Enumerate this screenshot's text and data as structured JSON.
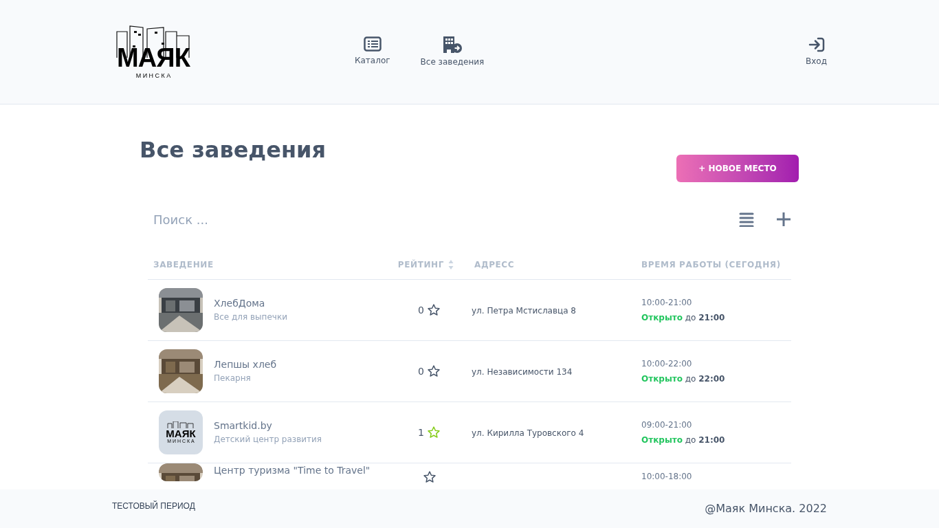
{
  "header": {
    "logo": {
      "title": "МАЯК",
      "subtitle": "М И Н С К А"
    },
    "nav": [
      {
        "label": "Каталог",
        "kind": "catalog"
      },
      {
        "label": "Все заведения",
        "kind": "places"
      }
    ],
    "login": {
      "label": "Вход"
    }
  },
  "page": {
    "title": "Все заведения",
    "new_button": "+ НОВОЕ МЕСТО",
    "search": {
      "placeholder": "Поиск ..."
    }
  },
  "table": {
    "columns": [
      {
        "label": "ЗАВЕДЕНИЕ",
        "sortable": false
      },
      {
        "label": "РЕЙТИНГ",
        "sortable": true
      },
      {
        "label": "АДРЕСС",
        "sortable": false
      },
      {
        "label": "ВРЕМЯ РАБОТЫ (СЕГОДНЯ)",
        "sortable": false
      }
    ],
    "rows": [
      {
        "name": "ХлебДома",
        "category": "Все для выпечки",
        "rating": "0",
        "starred": false,
        "address": "ул. Петра Мстиславца 8",
        "hours": "10:00-21:00",
        "status": "Открыто",
        "until_label": "до",
        "until": "21:00"
      },
      {
        "name": "Лепшы хлеб",
        "category": "Пекарня",
        "rating": "0",
        "starred": false,
        "address": "ул. Независимости 134",
        "hours": "10:00-22:00",
        "status": "Открыто",
        "until_label": "до",
        "until": "22:00"
      },
      {
        "thumb": {
          "kind": "logo",
          "title": "МАЯК",
          "subtitle": "М И Н С К А"
        },
        "name": "Smartkid.by",
        "category": "Детский центр развития",
        "rating": "1",
        "starred": true,
        "address": "ул. Кирилла Туровского 4",
        "hours": "09:00-21:00",
        "status": "Открыто",
        "until_label": "до",
        "until": "21:00"
      },
      {
        "name": "Центр туризма \"Time to Travel\"",
        "starred": false,
        "hours": "10:00-18:00"
      }
    ]
  },
  "footer": {
    "left": "ТЕСТОВЫЙ ПЕРИОД",
    "right": "@Маяк Минска. 2022"
  }
}
